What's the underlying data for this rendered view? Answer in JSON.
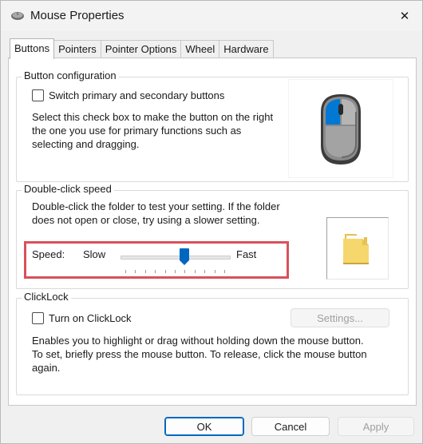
{
  "window": {
    "title": "Mouse Properties",
    "close_glyph": "✕"
  },
  "tabs": [
    {
      "label": "Buttons",
      "active": true
    },
    {
      "label": "Pointers",
      "active": false
    },
    {
      "label": "Pointer Options",
      "active": false
    },
    {
      "label": "Wheel",
      "active": false
    },
    {
      "label": "Hardware",
      "active": false
    }
  ],
  "button_config": {
    "title": "Button configuration",
    "checkbox_label": "Switch primary and secondary buttons",
    "checked": false,
    "description_lines": [
      "Select this check box to make the button on the right",
      "the one you use for primary functions such as",
      "selecting and dragging."
    ],
    "picture_icon": "mouse-icon",
    "highlight_color": "#0078d4"
  },
  "double_click": {
    "title": "Double-click speed",
    "description_lines": [
      "Double-click the folder to test your setting. If the folder",
      "does not open or close, try using a slower setting."
    ],
    "speed_label": "Speed:",
    "slow_label": "Slow",
    "fast_label": "Fast",
    "speed_value_fraction": 0.6,
    "tick_count": 11,
    "folder_icon": "folder-icon",
    "thumb_color": "#0067c0",
    "highlight_box_color": "#d9515b"
  },
  "clicklock": {
    "title": "ClickLock",
    "checkbox_label": "Turn on ClickLock",
    "checked": false,
    "settings_label": "Settings...",
    "description_lines": [
      "Enables you to highlight or drag without holding down the mouse button.",
      "To set, briefly press the mouse button. To release, click the mouse button",
      "again."
    ]
  },
  "footer": {
    "ok_label": "OK",
    "cancel_label": "Cancel",
    "apply_label": "Apply"
  }
}
